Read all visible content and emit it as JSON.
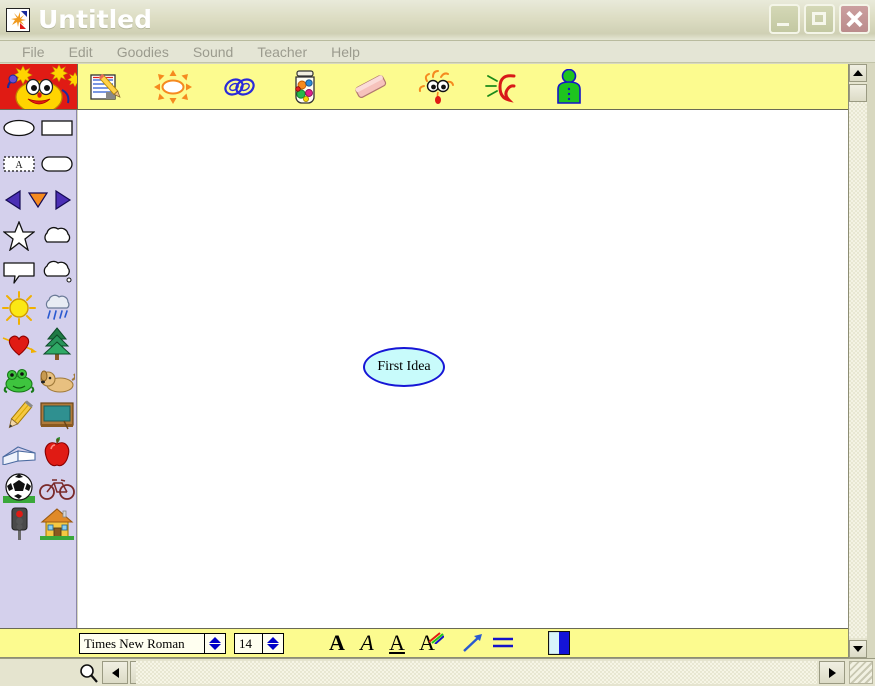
{
  "window": {
    "title": "Untitled",
    "app_icon": "kidspiration-starburst-icon",
    "buttons": {
      "minimize": "minimize-button",
      "maximize": "maximize-button",
      "close": "close-button"
    }
  },
  "menubar": {
    "items": [
      {
        "label": "File"
      },
      {
        "label": "Edit"
      },
      {
        "label": "Goodies"
      },
      {
        "label": "Sound"
      },
      {
        "label": "Teacher"
      },
      {
        "label": "Help"
      }
    ]
  },
  "toolbar": {
    "mascot": "smiling-sun-mascot-icon",
    "buttons": [
      {
        "name": "writing-view-icon",
        "label": "Writing"
      },
      {
        "name": "rapidfire-sun-icon",
        "label": "RapidFire"
      },
      {
        "name": "chain-link-icon",
        "label": "Link"
      },
      {
        "name": "symbol-jar-icon",
        "label": "Symbol Maker"
      },
      {
        "name": "eraser-icon",
        "label": "Clear"
      },
      {
        "name": "silly-face-icon",
        "label": "Sound Symbol"
      },
      {
        "name": "listening-ear-icon",
        "label": "Listen"
      },
      {
        "name": "person-icon",
        "label": "Student"
      }
    ]
  },
  "palette": {
    "rows": [
      [
        {
          "name": "oval-shape-icon"
        },
        {
          "name": "rectangle-shape-icon"
        }
      ],
      [
        {
          "name": "text-box-shape-icon",
          "letter": "A"
        },
        {
          "name": "rounded-rect-shape-icon"
        }
      ],
      [
        {
          "name": "arrow-left-icon"
        },
        {
          "name": "arrow-down-icon"
        },
        {
          "name": "arrow-right-icon"
        }
      ],
      [
        {
          "name": "star-shape-icon"
        },
        {
          "name": "cloud-shape-icon"
        }
      ],
      [
        {
          "name": "speech-bubble-icon"
        },
        {
          "name": "thought-bubble-icon"
        }
      ],
      [
        {
          "name": "sun-icon"
        },
        {
          "name": "rain-cloud-icon"
        }
      ],
      [
        {
          "name": "heart-icon"
        },
        {
          "name": "pine-tree-icon"
        }
      ],
      [
        {
          "name": "frog-icon"
        },
        {
          "name": "dog-icon"
        }
      ],
      [
        {
          "name": "pencil-icon"
        },
        {
          "name": "chalkboard-icon"
        }
      ],
      [
        {
          "name": "open-book-icon"
        },
        {
          "name": "apple-icon"
        }
      ],
      [
        {
          "name": "soccer-ball-icon"
        },
        {
          "name": "bicycle-icon"
        }
      ],
      [
        {
          "name": "traffic-light-icon"
        },
        {
          "name": "house-icon"
        }
      ]
    ]
  },
  "canvas": {
    "nodes": [
      {
        "name": "idea-node",
        "text": "First Idea",
        "fill": "#c8fbfb",
        "border": "#1616d6"
      }
    ]
  },
  "formatbar": {
    "font_name": "Times New Roman",
    "font_size": "14",
    "buttons": [
      {
        "name": "bold-button",
        "label": "A"
      },
      {
        "name": "italic-button",
        "label": "A"
      },
      {
        "name": "underline-button",
        "label": "A"
      },
      {
        "name": "font-color-button",
        "label": "A"
      },
      {
        "name": "line-style-button",
        "label": ""
      },
      {
        "name": "align-button",
        "label": ""
      },
      {
        "name": "fill-color-swatch",
        "label": ""
      }
    ]
  },
  "scrollbars": {
    "zoom_icon": "magnifier-zoom-icon",
    "v_up": "scroll-up-arrow",
    "v_down": "scroll-down-arrow",
    "h_left": "scroll-left-arrow",
    "h_right": "scroll-right-arrow",
    "resize_grip": "resize-grip"
  },
  "colors": {
    "titlebar": "#dcdcc2",
    "toolbar": "#fcfb8f",
    "palette": "#d4d0ec",
    "canvas": "#ffffff",
    "mascot_banner": "#e01b14",
    "node_fill": "#c8fbfb",
    "node_border": "#1616d6"
  }
}
